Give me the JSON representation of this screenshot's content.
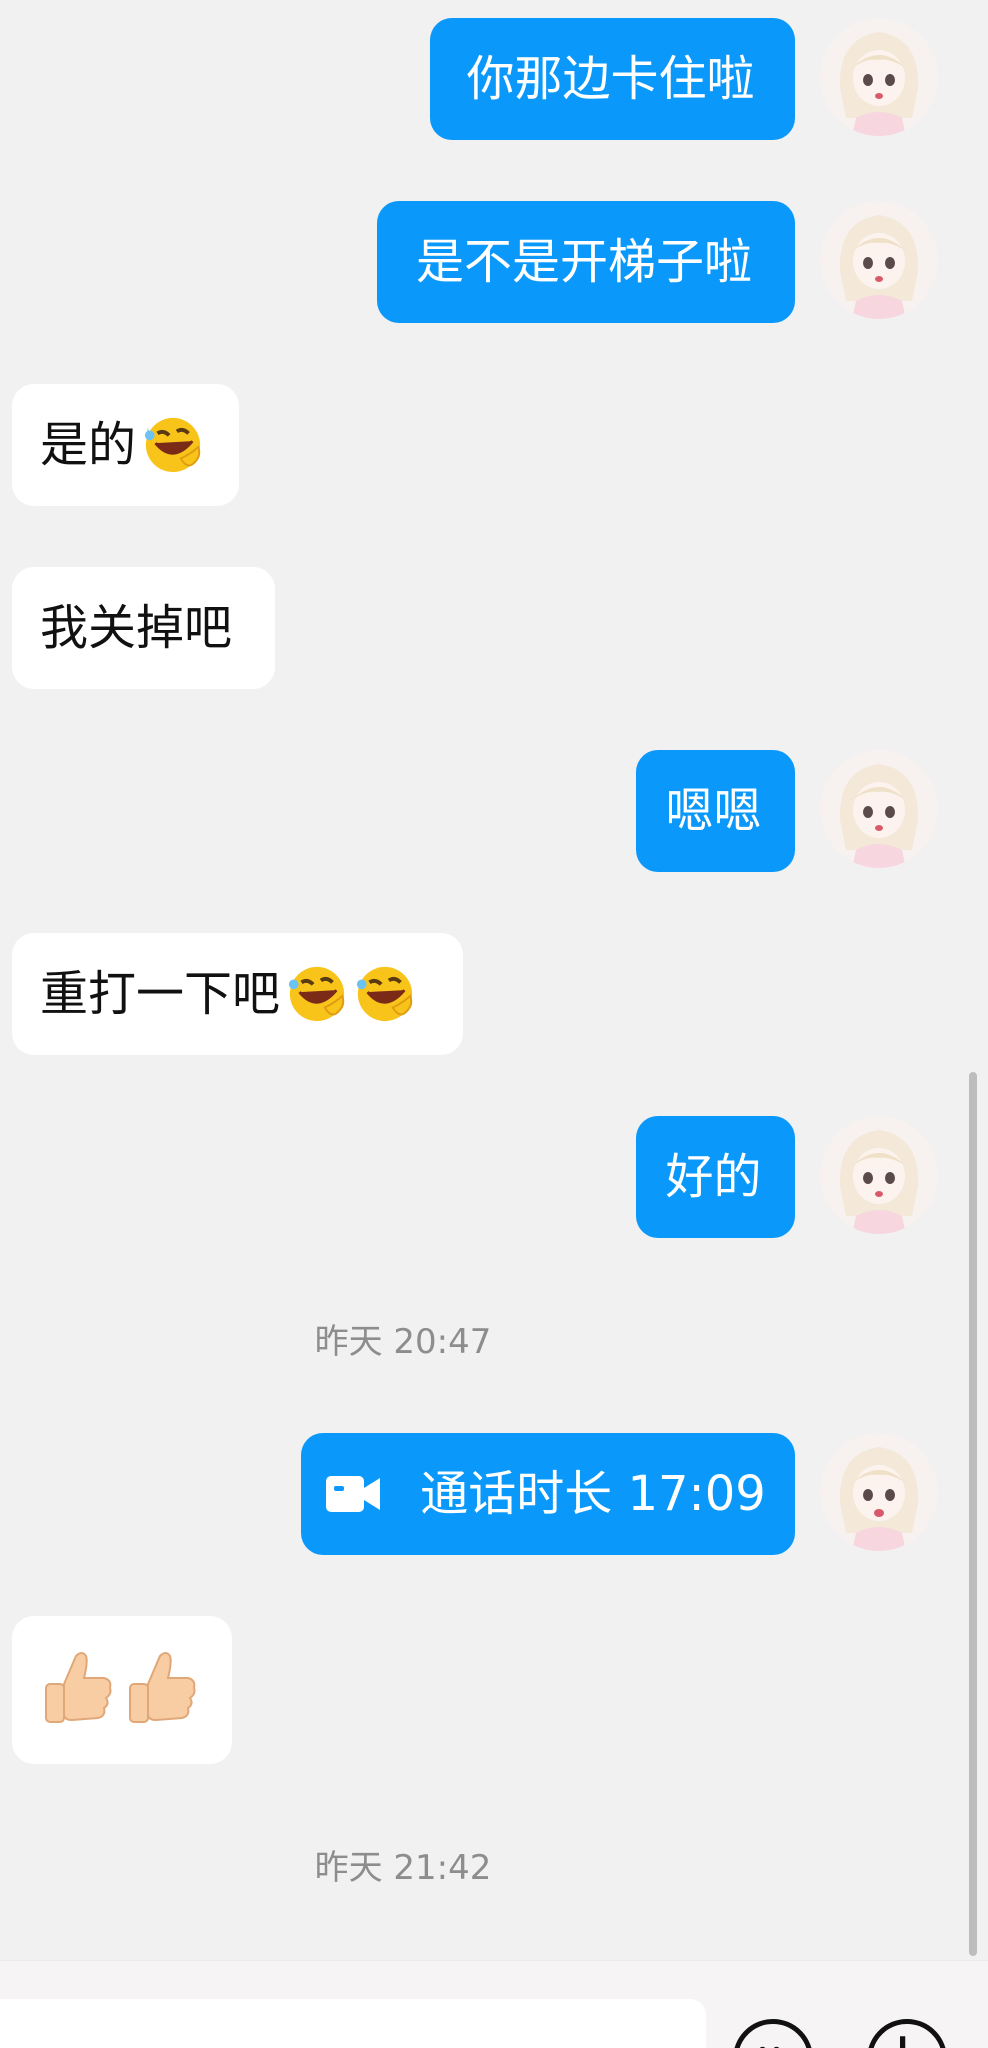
{
  "messages": [
    {
      "side": "out",
      "text": "你那边卡住啦"
    },
    {
      "side": "out",
      "text": "是不是开梯子啦"
    },
    {
      "side": "in",
      "text": "是的"
    },
    {
      "side": "in",
      "text": "我关掉吧"
    },
    {
      "side": "out",
      "text": "嗯嗯"
    },
    {
      "side": "in",
      "text": "重打一下吧"
    },
    {
      "side": "out",
      "text": "好的"
    },
    {
      "side": "time",
      "text": "昨天 20:47"
    },
    {
      "side": "out-call",
      "text": "通话时长 17:09"
    },
    {
      "side": "in",
      "text": ""
    },
    {
      "side": "time",
      "text": "昨天 21:42"
    }
  ],
  "icons": {
    "laugh_emoji": "rolling-laugh-emoji",
    "thumbs_emoji": "thumbs-up-emoji",
    "call": "video-camera-icon"
  },
  "colors": {
    "outgoing_bubble": "#0a99fb",
    "incoming_bubble": "#ffffff",
    "background": "#f1f1f1",
    "timestamp": "#8d8d8d"
  }
}
